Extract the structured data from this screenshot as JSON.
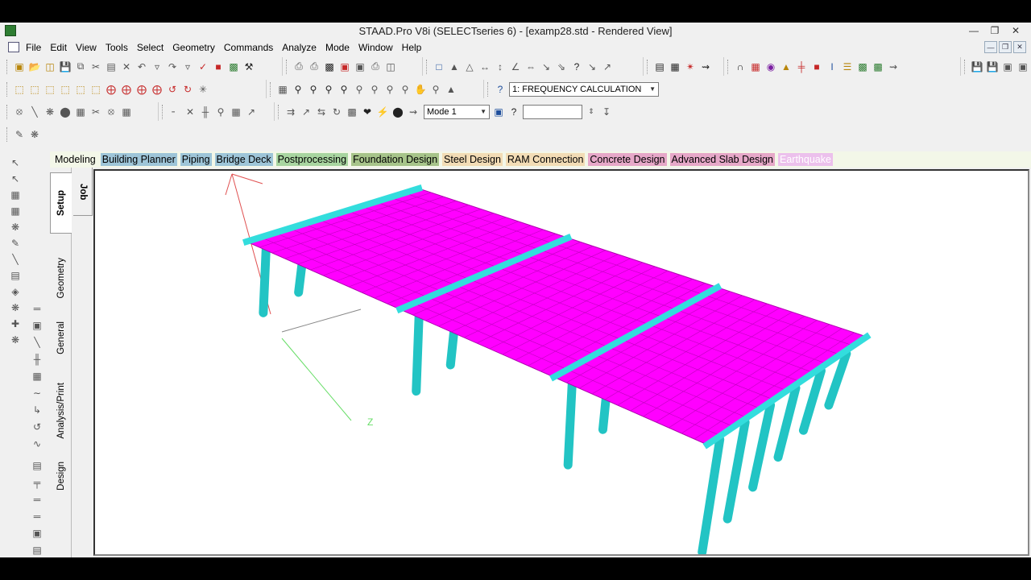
{
  "window": {
    "title": "STAAD.Pro V8i (SELECTseries 6) - [examp28.std - Rendered View]",
    "minimize": "—",
    "restore": "❐",
    "close": "✕"
  },
  "menu": [
    "File",
    "Edit",
    "View",
    "Tools",
    "Select",
    "Geometry",
    "Commands",
    "Analyze",
    "Mode",
    "Window",
    "Help"
  ],
  "toolbar": {
    "load_case_select": "1: FREQUENCY CALCULATION",
    "mode_select": "Mode 1",
    "mode_value": ""
  },
  "page_tabs": [
    {
      "label": "Modeling",
      "color": "#f3f7e8"
    },
    {
      "label": "Building Planner",
      "color": "#9ec5d8"
    },
    {
      "label": "Piping",
      "color": "#9ec5d8"
    },
    {
      "label": "Bridge Deck",
      "color": "#9ec5d8"
    },
    {
      "label": "Postprocessing",
      "color": "#a8d5a0"
    },
    {
      "label": "Foundation Design",
      "color": "#a7c48a"
    },
    {
      "label": "Steel Design",
      "color": "#f2dcb5"
    },
    {
      "label": "RAM Connection",
      "color": "#f2dcb5"
    },
    {
      "label": "Concrete Design",
      "color": "#e6a8c8"
    },
    {
      "label": "Advanced Slab Design",
      "color": "#e6a8c8"
    },
    {
      "label": "Earthquake",
      "color": "#ecc0ec"
    }
  ],
  "side_tabs": {
    "setup": "Setup",
    "geometry": "Geometry",
    "general": "General",
    "analysis_print": "Analysis/Print",
    "design": "Design",
    "job": "Job"
  },
  "viewport": {
    "axis_label": "Z",
    "deck_color": "#ff00ff",
    "beam_color": "#33dddd",
    "column_color": "#22c4c4"
  }
}
